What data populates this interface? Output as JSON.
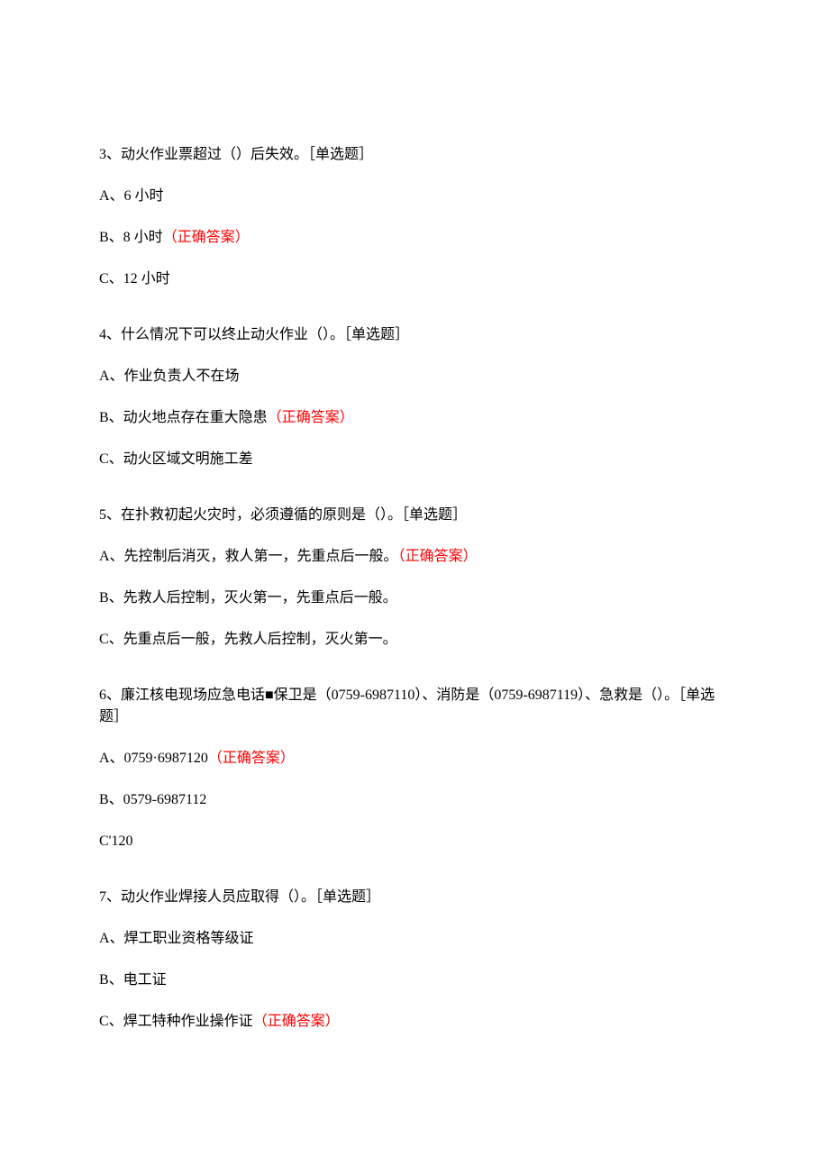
{
  "answer_label": "（正确答案）",
  "questions": [
    {
      "stem": "3、动火作业票超过（）后失效。［单选题］",
      "options": [
        {
          "text": "A、6 小时",
          "correct": false
        },
        {
          "text": "B、8 小时",
          "correct": true
        },
        {
          "text": "C、12 小时",
          "correct": false
        }
      ]
    },
    {
      "stem": "4、什么情况下可以终止动火作业（）。［单选题］",
      "options": [
        {
          "text": "A、作业负责人不在场",
          "correct": false
        },
        {
          "text": "B、动火地点存在重大隐患",
          "correct": true
        },
        {
          "text": "C、动火区域文明施工差",
          "correct": false
        }
      ]
    },
    {
      "stem": "5、在扑救初起火灾时，必须遵循的原则是（）。［单选题］",
      "options": [
        {
          "text": "A、先控制后消灭，救人第一，先重点后一般。",
          "correct": true
        },
        {
          "text": "B、先救人后控制，灭火第一，先重点后一般。",
          "correct": false
        },
        {
          "text": "C、先重点后一般，先救人后控制，灭火第一。",
          "correct": false
        }
      ]
    },
    {
      "stem": "6、廉江核电现场应急电话■保卫是（0759-6987110）、消防是（0759-6987119）、急救是（）。［单选题］",
      "options": [
        {
          "text": "A、0759·6987120",
          "correct": true
        },
        {
          "text": "B、0579-6987112",
          "correct": false
        },
        {
          "text": "C'120",
          "correct": false
        }
      ]
    },
    {
      "stem": "7、动火作业焊接人员应取得（）。［单选题］",
      "options": [
        {
          "text": "A、焊工职业资格等级证",
          "correct": false
        },
        {
          "text": "B、电工证",
          "correct": false
        },
        {
          "text": "C、焊工特种作业操作证",
          "correct": true
        }
      ]
    }
  ]
}
